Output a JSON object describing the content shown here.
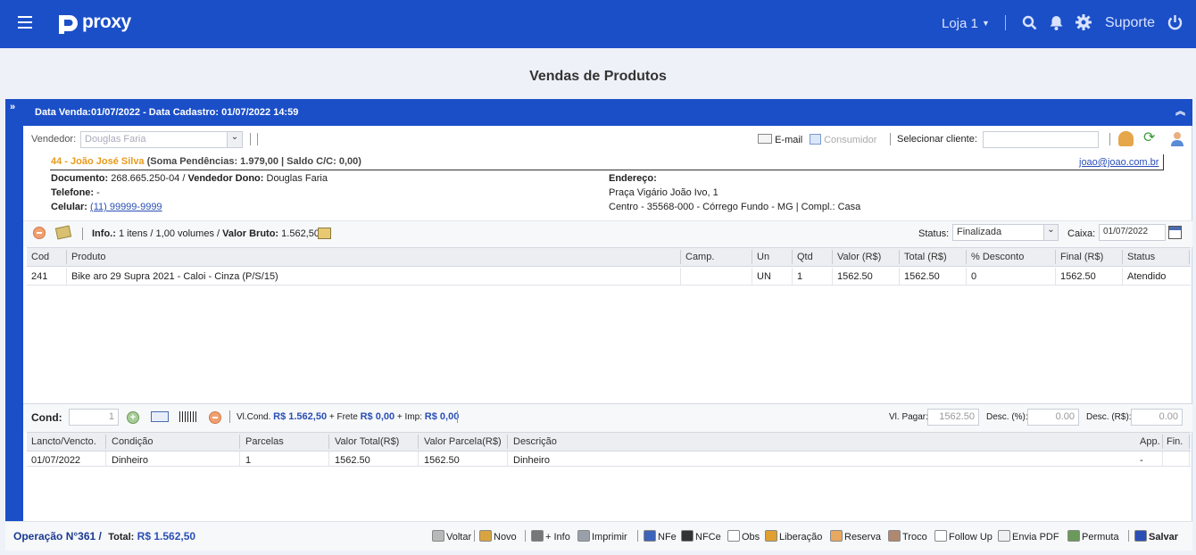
{
  "topbar": {
    "brand": "proxy",
    "store": "Loja 1",
    "support": "Suporte"
  },
  "page_title": "Vendas de Produtos",
  "panel": {
    "header": "Data Venda:01/07/2022 - Data Cadastro: 01/07/2022 14:59"
  },
  "seller": {
    "label": "Vendedor:",
    "value": "Douglas Faria"
  },
  "client_bar": {
    "email": "E-mail",
    "consumer": "Consumidor",
    "select_label": "Selecionar cliente:"
  },
  "client": {
    "title": "44 - João José Silva",
    "summary": "(Soma Pendências: 1.979,00 | Saldo C/C: 0,00)",
    "email": "joao@joao.com.br",
    "doc_label": "Documento:",
    "doc": "268.665.250-04 /",
    "owner_label": "Vendedor Dono:",
    "owner": "Douglas Faria",
    "phone_label": "Telefone:",
    "phone": "-",
    "cell_label": "Celular:",
    "cell": "(11) 99999-9999",
    "addr_label": "Endereço:",
    "addr1": "Praça Vigário João Ivo, 1",
    "addr2": "Centro - 35568-000 - Córrego Fundo - MG | Compl.: Casa"
  },
  "info": {
    "label": "Info.:",
    "text": "1 itens / 1,00 volumes /",
    "gross_label": "Valor Bruto:",
    "gross": "1.562,50",
    "status_label": "Status:",
    "status": "Finalizada",
    "cash_label": "Caixa:",
    "cash": "01/07/2022"
  },
  "items": {
    "headers": [
      "Cod",
      "Produto",
      "Camp.",
      "Un",
      "Qtd",
      "Valor (R$)",
      "Total (R$)",
      "% Desconto",
      "Final (R$)",
      "Status"
    ],
    "rows": [
      [
        "241",
        "Bike aro 29 Supra 2021 - Caloi - Cinza (P/S/15)",
        "",
        "UN",
        "1",
        "1562.50",
        "1562.50",
        "0",
        "1562.50",
        "Atendido"
      ]
    ]
  },
  "cond": {
    "label": "Cond:",
    "qty": "1",
    "vlcond_label": "Vl.Cond.",
    "vlcond": "R$ 1.562,50",
    "frete_label": "+ Frete",
    "frete": "R$ 0,00",
    "imp_label": "+ Imp:",
    "imp": "R$ 0,00",
    "pay_label": "Vl. Pagar:",
    "pay": "1562.50",
    "descp_label": "Desc. (%):",
    "descp": "0.00",
    "descr_label": "Desc. (R$):",
    "descr": "0.00"
  },
  "parcels": {
    "headers": [
      "Lancto/Vencto.",
      "Condição",
      "Parcelas",
      "Valor Total(R$)",
      "Valor Parcela(R$)",
      "Descrição",
      "App.",
      "Fin."
    ],
    "rows": [
      [
        "01/07/2022",
        "Dinheiro",
        "1",
        "1562.50",
        "1562.50",
        "Dinheiro",
        "-",
        ""
      ]
    ]
  },
  "footer": {
    "op": "Operação N°361 /",
    "total_label": "Total:",
    "total": "R$ 1.562,50",
    "buttons": [
      "Voltar",
      "Novo",
      "+ Info",
      "Imprimir",
      "NFe",
      "NFCe",
      "Obs",
      "Liberação",
      "Reserva",
      "Troco",
      "Follow Up",
      "Envia PDF",
      "Permuta",
      "Salvar"
    ]
  }
}
